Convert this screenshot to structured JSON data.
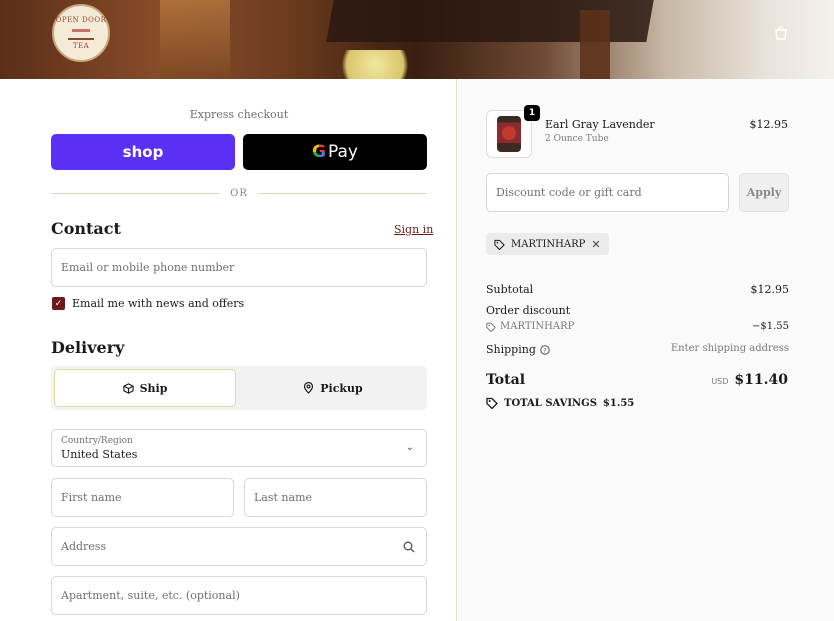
{
  "header": {
    "logo_top": "OPEN DOOR",
    "logo_bottom": "TEA",
    "cart_icon": "shopping-bag-icon"
  },
  "express": {
    "label": "Express checkout",
    "shop_pay": "shop",
    "google_pay": "Pay",
    "google_g": "G",
    "divider": "OR"
  },
  "contact": {
    "heading": "Contact",
    "sign_in": "Sign in",
    "email_placeholder": "Email or mobile phone number",
    "newsletter_label": "Email me with news and offers",
    "newsletter_checked": true
  },
  "delivery": {
    "heading": "Delivery",
    "tabs": [
      {
        "label": "Ship",
        "icon": "box-icon",
        "selected": true
      },
      {
        "label": "Pickup",
        "icon": "location-pin-icon",
        "selected": false
      }
    ],
    "country_label": "Country/Region",
    "country_value": "United States",
    "first_name": "First name",
    "last_name": "Last name",
    "address": "Address",
    "apartment": "Apartment, suite, etc. (optional)"
  },
  "summary": {
    "item": {
      "quantity": "1",
      "name": "Earl Gray Lavender",
      "variant": "2 Ounce Tube",
      "price": "$12.95"
    },
    "discount_placeholder": "Discount code or gift card",
    "apply": "Apply",
    "applied_code": "MARTINHARP",
    "subtotal_label": "Subtotal",
    "subtotal_value": "$12.95",
    "order_discount_label": "Order discount",
    "discount_code": "MARTINHARP",
    "discount_value": "−$1.55",
    "shipping_label": "Shipping",
    "shipping_value": "Enter shipping address",
    "total_label": "Total",
    "total_currency": "USD",
    "total_value": "$11.40",
    "savings_label": "TOTAL SAVINGS",
    "savings_value": "$1.55"
  },
  "colors": {
    "accent": "#6b1b1b",
    "shop_pay": "#5a31f4",
    "google_pay": "#000000"
  }
}
